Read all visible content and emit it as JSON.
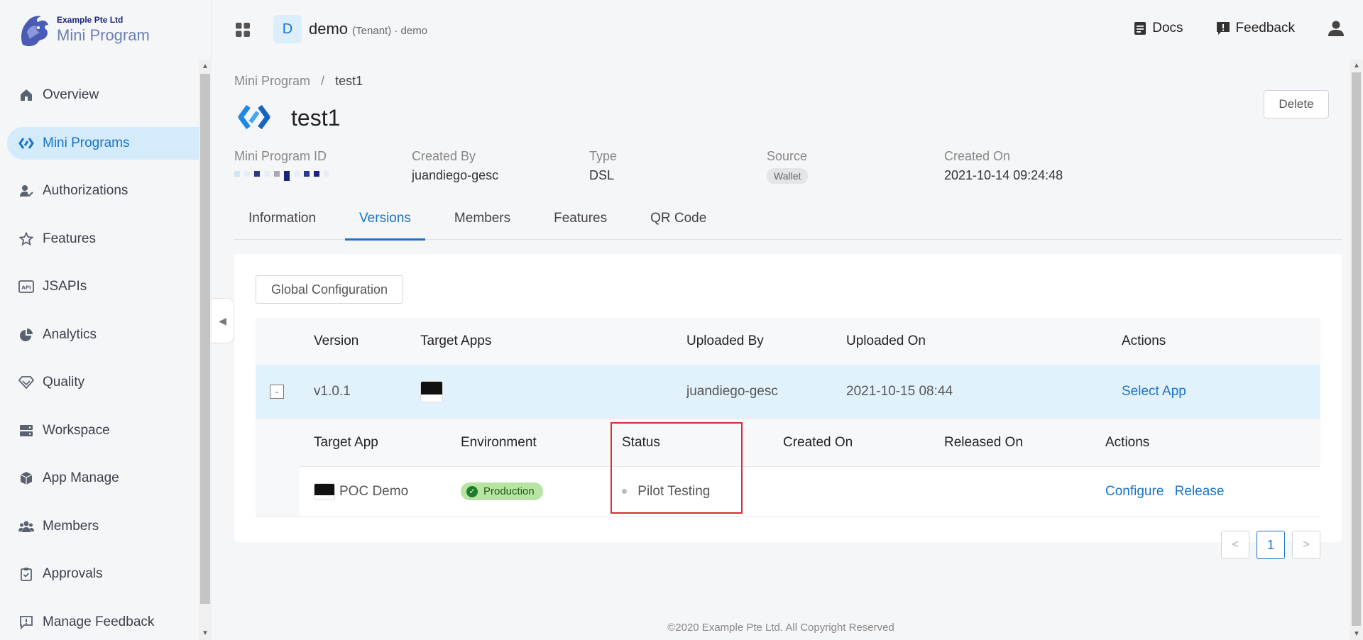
{
  "brand": {
    "company": "Example Pte Ltd",
    "product": "Mini Program"
  },
  "sidebar": {
    "items": [
      {
        "label": "Overview",
        "icon": "home-icon"
      },
      {
        "label": "Mini Programs",
        "icon": "mini-program-icon",
        "active": true
      },
      {
        "label": "Authorizations",
        "icon": "user-check-icon"
      },
      {
        "label": "Features",
        "icon": "star-icon"
      },
      {
        "label": "JSAPIs",
        "icon": "api-icon"
      },
      {
        "label": "Analytics",
        "icon": "pie-chart-icon"
      },
      {
        "label": "Quality",
        "icon": "diamond-icon"
      },
      {
        "label": "Workspace",
        "icon": "server-icon"
      },
      {
        "label": "App Manage",
        "icon": "box-icon"
      },
      {
        "label": "Members",
        "icon": "group-icon"
      },
      {
        "label": "Approvals",
        "icon": "clipboard-icon"
      },
      {
        "label": "Manage Feedback",
        "icon": "feedback-icon"
      }
    ]
  },
  "header": {
    "tenant_initial": "D",
    "tenant_name": "demo",
    "tenant_suffix": "(Tenant) · demo",
    "docs": "Docs",
    "feedback": "Feedback"
  },
  "breadcrumb": {
    "root": "Mini Program",
    "sep": "/",
    "current": "test1"
  },
  "app": {
    "title": "test1",
    "delete": "Delete"
  },
  "meta": {
    "id_label": "Mini Program ID",
    "created_by_label": "Created By",
    "created_by": "juandiego-gesc",
    "type_label": "Type",
    "type": "DSL",
    "source_label": "Source",
    "source": "Wallet",
    "created_on_label": "Created On",
    "created_on": "2021-10-14 09:24:48"
  },
  "tabs": [
    "Information",
    "Versions",
    "Members",
    "Features",
    "QR Code"
  ],
  "active_tab": "Versions",
  "versions": {
    "global_config": "Global Configuration",
    "headers": {
      "version": "Version",
      "target_apps": "Target Apps",
      "uploaded_by": "Uploaded By",
      "uploaded_on": "Uploaded On",
      "actions": "Actions"
    },
    "row": {
      "expand": "-",
      "version": "v1.0.1",
      "uploaded_by": "juandiego-gesc",
      "uploaded_on": "2021-10-15 08:44",
      "action": "Select App"
    },
    "sub_headers": {
      "target_app": "Target App",
      "environment": "Environment",
      "status": "Status",
      "created_on": "Created On",
      "released_on": "Released On",
      "actions": "Actions"
    },
    "sub_row": {
      "app": "POC Demo",
      "environment": "Production",
      "status": "Pilot Testing",
      "created_on": "",
      "released_on": "",
      "configure": "Configure",
      "release": "Release"
    }
  },
  "pagination": {
    "prev": "<",
    "page": "1",
    "next": ">"
  },
  "footer": "©2020 Example Pte Ltd. All Copyright Reserved",
  "colors": {
    "accent": "#1a73c9",
    "active_nav_bg": "#d3ebfb",
    "highlight": "#d32f2f"
  }
}
